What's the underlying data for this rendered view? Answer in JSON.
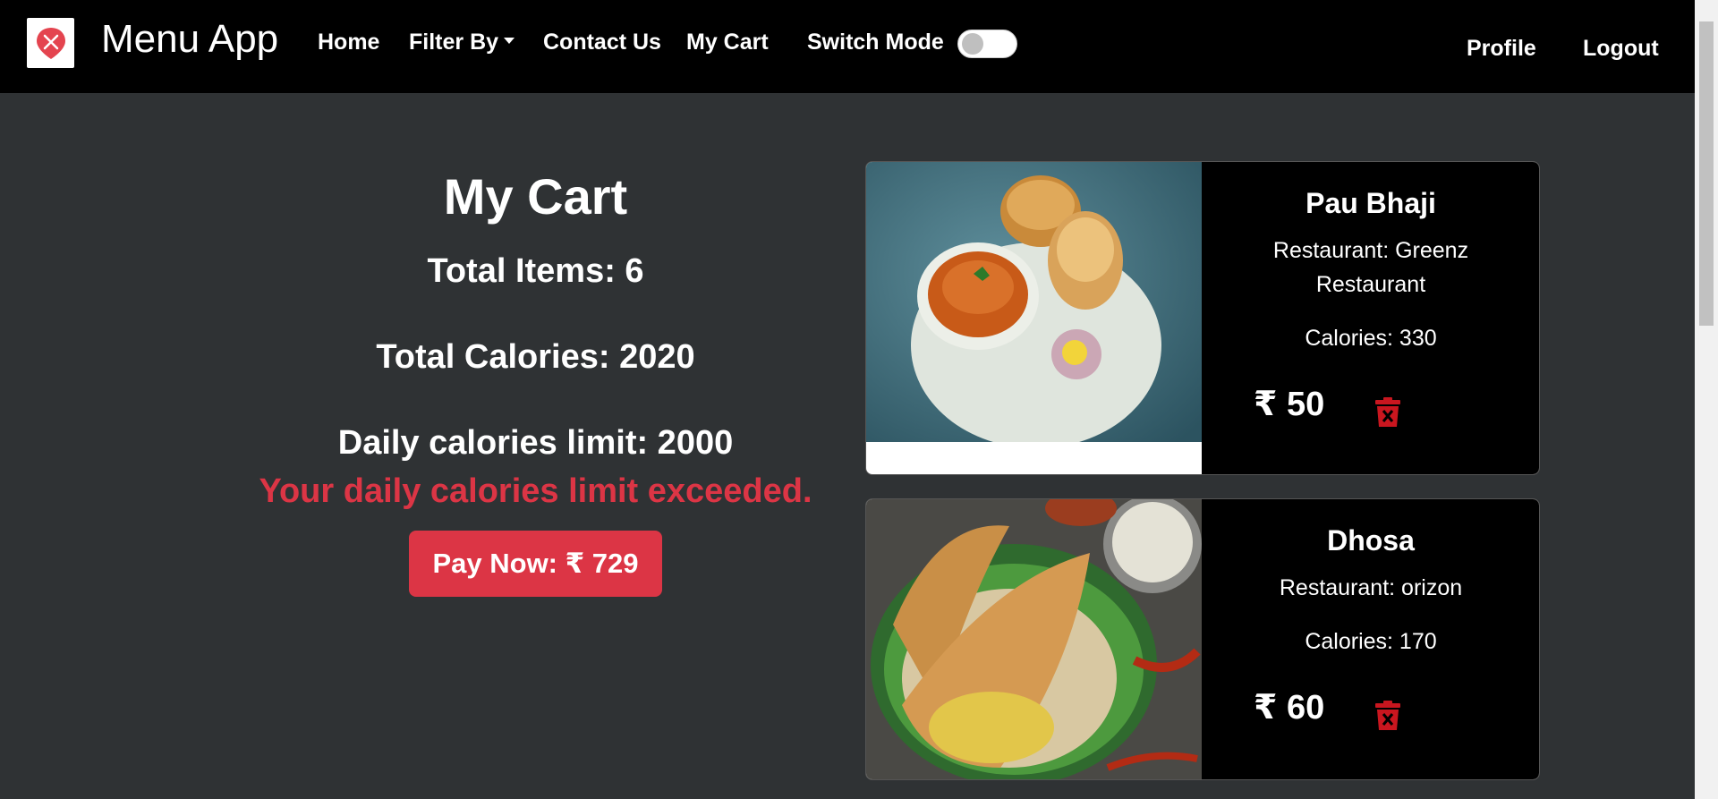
{
  "navbar": {
    "brand": "Menu App",
    "links": {
      "home": "Home",
      "filter": "Filter By",
      "contact": "Contact Us",
      "cart": "My Cart",
      "switch": "Switch Mode"
    },
    "right": {
      "profile": "Profile",
      "logout": "Logout"
    },
    "switch_on": false
  },
  "summary": {
    "title": "My Cart",
    "total_items": "Total Items: 6",
    "total_calories": "Total Calories: 2020",
    "daily_limit": "Daily calories limit: 2000",
    "warning": "Your daily calories limit exceeded.",
    "pay_button": "Pay Now: ₹ 729"
  },
  "cart": [
    {
      "name": "Pau Bhaji",
      "restaurant": "Restaurant: Greenz Restaurant",
      "calories": "Calories: 330",
      "price": "₹ 50",
      "image_icon": "pav-bhaji-photo"
    },
    {
      "name": "Dhosa",
      "restaurant": "Restaurant: orizon",
      "calories": "Calories: 170",
      "price": "₹ 60",
      "image_icon": "dosa-photo"
    }
  ],
  "colors": {
    "nav_bg": "#000000",
    "page_bg": "#2f3234",
    "accent_red": "#dc3545"
  }
}
